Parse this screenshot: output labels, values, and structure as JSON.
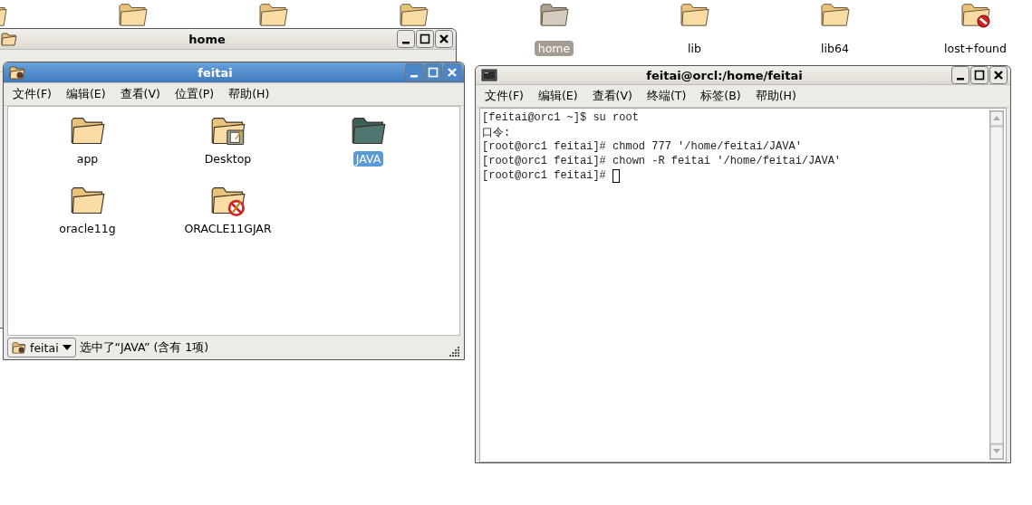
{
  "desktop_icons": [
    {
      "kind": "folder",
      "selected": false
    },
    {
      "kind": "folder",
      "selected": false
    },
    {
      "kind": "folder",
      "selected": false
    },
    {
      "kind": "folder",
      "selected": false
    },
    {
      "kind": "folder",
      "label": "home",
      "selected": true
    },
    {
      "kind": "folder",
      "label": "lib",
      "selected": false
    },
    {
      "kind": "folder",
      "label": "lib64",
      "selected": false
    },
    {
      "kind": "noaccess",
      "label": "lost+found",
      "selected": false
    }
  ],
  "home_window": {
    "title": "home",
    "active": false
  },
  "file_window": {
    "title": "feitai",
    "active": true,
    "menu": [
      "文件(F)",
      "编辑(E)",
      "查看(V)",
      "位置(P)",
      "帮助(H)"
    ],
    "items": [
      {
        "kind": "folder",
        "label": "app",
        "selected": false
      },
      {
        "kind": "desktop",
        "label": "Desktop",
        "selected": false
      },
      {
        "kind": "folder",
        "label": "JAVA",
        "selected": true
      },
      {
        "kind": "folder",
        "label": "oracle11g",
        "selected": false
      },
      {
        "kind": "readonly",
        "label": "ORACLE11GJAR",
        "selected": false
      }
    ],
    "location_button": "feitai",
    "status": "选中了“JAVA” (含有 1项)"
  },
  "terminal_window": {
    "title": "feitai@orcl:/home/feitai",
    "active": false,
    "menu": [
      "文件(F)",
      "编辑(E)",
      "查看(V)",
      "终端(T)",
      "标签(B)",
      "帮助(H)"
    ],
    "lines": [
      "[feitai@orc1 ~]$ su root",
      "口令:",
      "[root@orc1 feitai]# chmod 777 '/home/feitai/JAVA'",
      "[root@orc1 feitai]# chown -R feitai '/home/feitai/JAVA'",
      "[root@orc1 feitai]# "
    ]
  }
}
